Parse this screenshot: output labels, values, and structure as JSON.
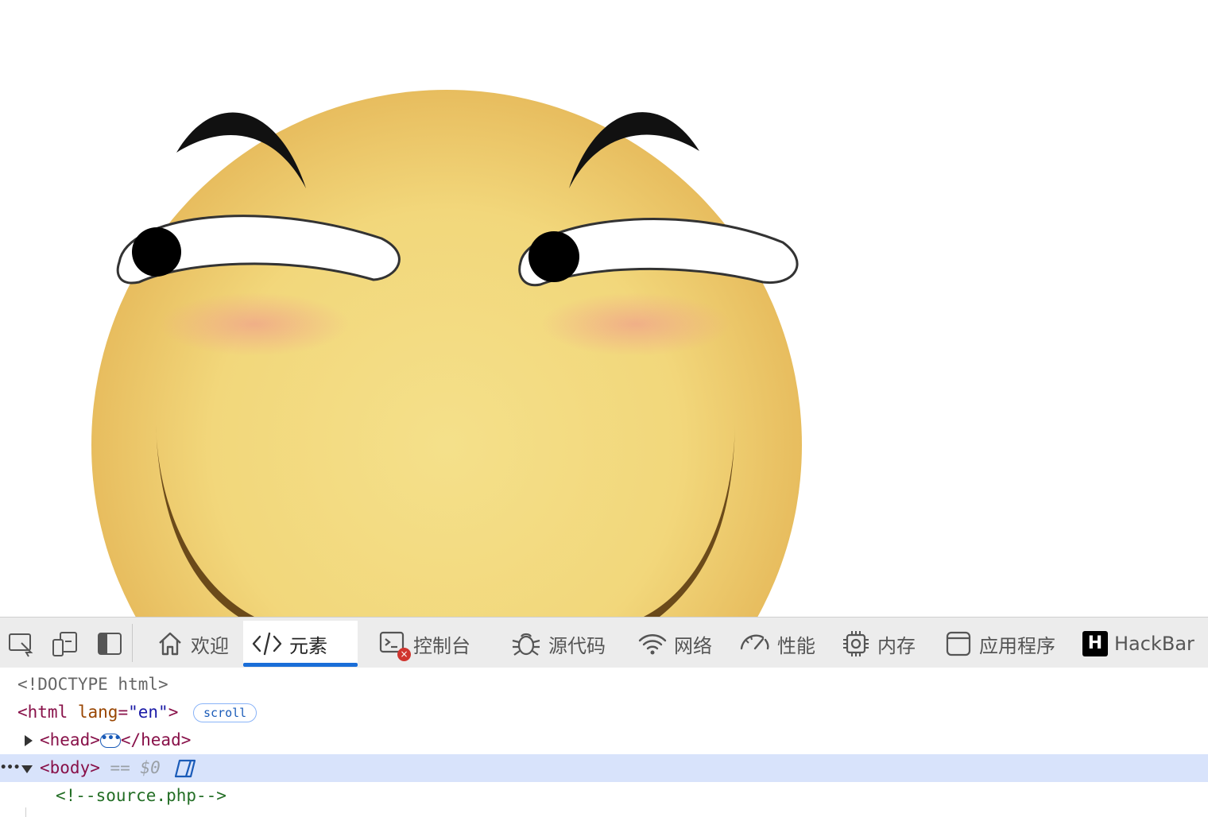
{
  "devtools": {
    "toolbar": {
      "icons": [
        "inspect-element-icon",
        "device-emulation-icon",
        "dock-side-icon"
      ],
      "tabs": [
        {
          "label": "欢迎",
          "icon": "home-icon"
        },
        {
          "label": "元素",
          "icon": "code-icon",
          "active": true
        },
        {
          "label": "控制台",
          "icon": "console-icon",
          "error_badge": "×"
        },
        {
          "label": "源代码",
          "icon": "bug-icon"
        },
        {
          "label": "网络",
          "icon": "wifi-icon"
        },
        {
          "label": "性能",
          "icon": "gauge-icon"
        },
        {
          "label": "内存",
          "icon": "chip-icon"
        },
        {
          "label": "应用程序",
          "icon": "window-icon"
        },
        {
          "label": "HackBar",
          "icon": "hackbar-icon",
          "icon_letter": "H"
        }
      ]
    },
    "dom_tree": {
      "doctype": "<!DOCTYPE html>",
      "html_open": "<html",
      "html_attr_name": "lang",
      "html_attr_eq": "=",
      "html_attr_value": "\"en\"",
      "html_close_bracket": ">",
      "scroll_badge": "scroll",
      "head_open": "<head>",
      "head_ellipsis": "•••",
      "head_close": "</head>",
      "row_ellipsis": "•••",
      "body_open": "<body>",
      "body_eq": "==",
      "body_ref": "$0",
      "comment": "<!--source.php-->"
    }
  },
  "colors": {
    "accent": "#1a6ed8",
    "selected_row": "#d8e3fb",
    "tag": "#881149",
    "attr": "#994500",
    "value": "#1a1aa6",
    "comment": "#236e25",
    "face": "#f3d97a"
  }
}
